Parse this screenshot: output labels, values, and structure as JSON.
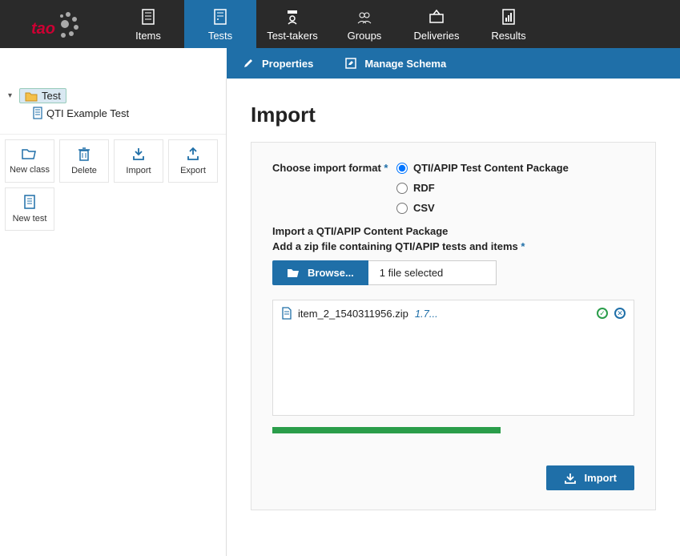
{
  "nav": {
    "items": [
      {
        "label": "Items"
      },
      {
        "label": "Tests"
      },
      {
        "label": "Test-takers"
      },
      {
        "label": "Groups"
      },
      {
        "label": "Deliveries"
      },
      {
        "label": "Results"
      }
    ]
  },
  "subnav": {
    "properties": "Properties",
    "manage_schema": "Manage Schema"
  },
  "tree": {
    "root": "Test",
    "child": "QTI Example Test"
  },
  "actions": {
    "new_class": "New class",
    "delete": "Delete",
    "import": "Import",
    "export": "Export",
    "new_test": "New test"
  },
  "page": {
    "title": "Import",
    "format_label": "Choose import format",
    "formats": {
      "qti": "QTI/APIP Test Content Package",
      "rdf": "RDF",
      "csv": "CSV"
    },
    "sub_heading": "Import a QTI/APIP Content Package",
    "sub_desc": "Add a zip file containing QTI/APIP tests and items",
    "browse": "Browse...",
    "file_status": "1 file selected",
    "file": {
      "name": "item_2_1540311956.zip",
      "size": "1.7..."
    },
    "import_btn": "Import"
  }
}
